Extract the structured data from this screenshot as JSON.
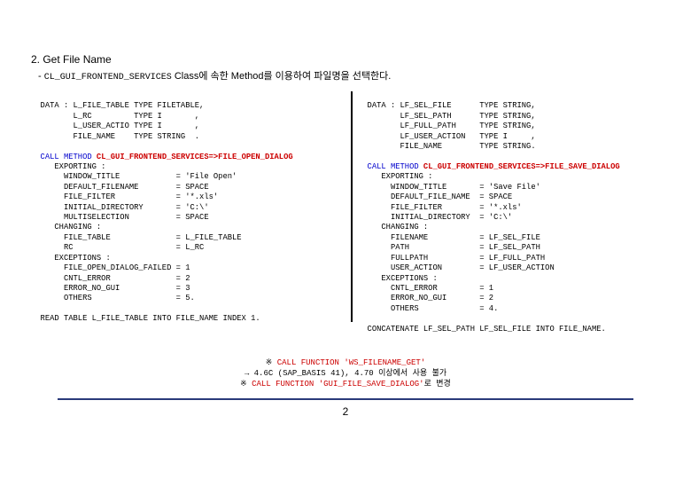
{
  "header": {
    "title": "2. Get File Name",
    "subtitle_prefix": "- ",
    "subtitle_class": "CL_GUI_FRONTEND_SERVICES",
    "subtitle_suffix": " Class에 속한 Method를 이용하여 파일명을 선택한다."
  },
  "left": {
    "data1": "  DATA : L_FILE_TABLE TYPE FILETABLE,",
    "data2": "         L_RC         TYPE I       ,",
    "data3": "         L_USER_ACTIO TYPE I       ,",
    "data4": "         FILE_NAME    TYPE STRING  .",
    "call1a": "  CALL METHOD",
    "call1b": " CL_GUI_FRONTEND_SERVICES=>FILE_OPEN_DIALOG",
    "exp": "     EXPORTING :",
    "l1": "       WINDOW_TITLE            = 'File Open'",
    "l2": "       DEFAULT_FILENAME        = SPACE",
    "l3": "       FILE_FILTER             = '*.xls'",
    "l4": "       INITIAL_DIRECTORY       = 'C:\\'",
    "l5": "       MULTISELECTION          = SPACE",
    "chg": "     CHANGING :",
    "l6": "       FILE_TABLE              = L_FILE_TABLE",
    "l7": "       RC                      = L_RC",
    "exc": "     EXCEPTIONS :",
    "l8": "       FILE_OPEN_DIALOG_FAILED = 1",
    "l9": "       CNTL_ERROR              = 2",
    "l10": "       ERROR_NO_GUI            = 3",
    "l11": "       OTHERS                  = 5.",
    "read": "  READ TABLE L_FILE_TABLE INTO FILE_NAME INDEX 1."
  },
  "right": {
    "d1": "  DATA : LF_SEL_FILE      TYPE STRING,",
    "d2": "         LF_SEL_PATH      TYPE STRING,",
    "d3": "         LF_FULL_PATH     TYPE STRING,",
    "d4": "         LF_USER_ACTION   TYPE I     ,",
    "d5": "         FILE_NAME        TYPE STRING.",
    "call2a": "  CALL METHOD",
    "call2b": " CL_GUI_FRONTEND_SERVICES=>FILE_SAVE_DIALOG",
    "exp": "     EXPORTING :",
    "r1": "       WINDOW_TITLE       = 'Save File'",
    "r2": "       DEFAULT_FILE_NAME  = SPACE",
    "r3": "       FILE_FILTER        = '*.xls'",
    "r4": "       INITIAL_DIRECTORY  = 'C:\\'",
    "chg": "     CHANGING :",
    "r5": "       FILENAME           = LF_SEL_FILE",
    "r6": "       PATH               = LF_SEL_PATH",
    "r7": "       FULLPATH           = LF_FULL_PATH",
    "r8": "       USER_ACTION        = LF_USER_ACTION",
    "exc": "     EXCEPTIONS :",
    "r9": "       CNTL_ERROR         = 1",
    "r10": "       ERROR_NO_GUI       = 2",
    "r11": "       OTHERS             = 4.",
    "concat": "  CONCATENATE LF_SEL_PATH LF_SEL_FILE INTO FILE_NAME."
  },
  "footnote": {
    "f1a": "※ ",
    "f1b": "CALL FUNCTION 'WS_FILENAME_GET'",
    "f2": "→ 4.6C (SAP_BASIS 41), 4.70 이상에서 사용 불가",
    "f3a": "※ ",
    "f3b": "CALL FUNCTION 'GUI_FILE_SAVE_DIALOG'",
    "f3c": "로 변경"
  },
  "page": "2"
}
